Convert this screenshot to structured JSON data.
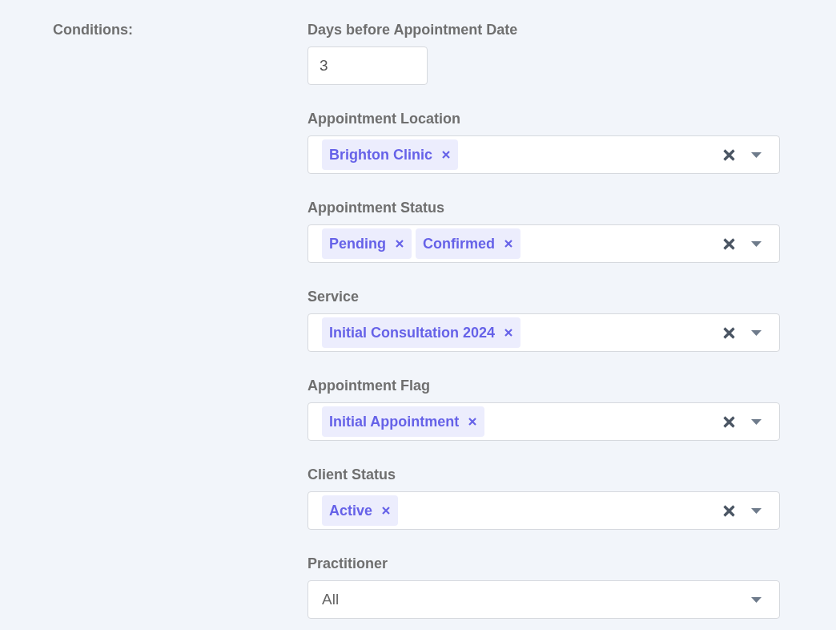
{
  "section_label": "Conditions:",
  "fields": [
    {
      "label": "Days before Appointment Date",
      "kind": "number",
      "value": "3"
    },
    {
      "label": "Appointment Location",
      "kind": "multiselect",
      "chips": [
        "Brighton Clinic"
      ]
    },
    {
      "label": "Appointment Status",
      "kind": "multiselect",
      "chips": [
        "Pending",
        "Confirmed"
      ]
    },
    {
      "label": "Service",
      "kind": "multiselect",
      "chips": [
        "Initial Consultation 2024"
      ]
    },
    {
      "label": "Appointment Flag",
      "kind": "multiselect",
      "chips": [
        "Initial Appointment"
      ]
    },
    {
      "label": "Client Status",
      "kind": "multiselect",
      "chips": [
        "Active"
      ]
    },
    {
      "label": "Practitioner",
      "kind": "select",
      "value": "All"
    }
  ]
}
